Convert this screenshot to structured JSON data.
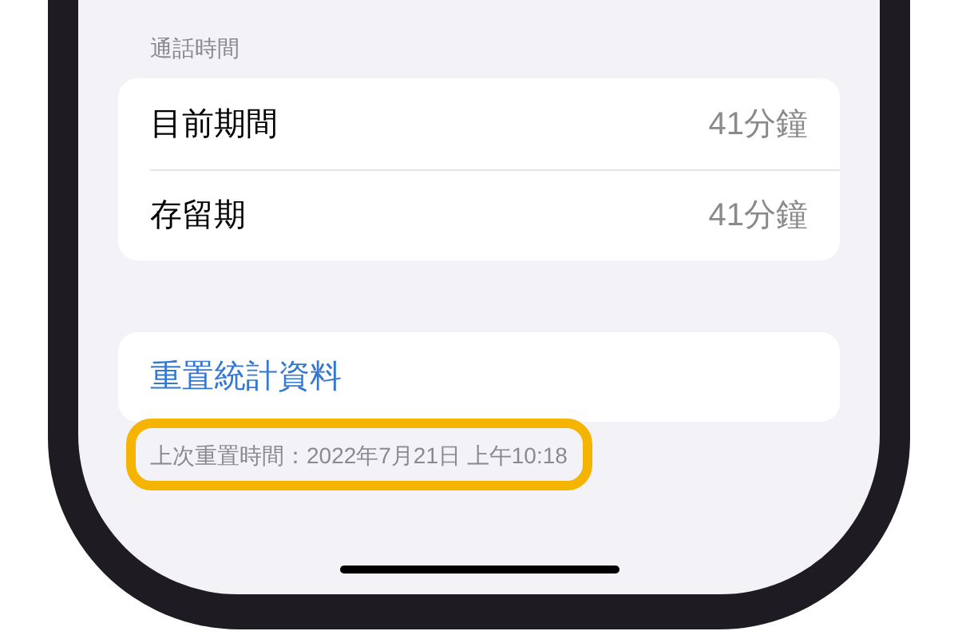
{
  "section_header": "通話時間",
  "call_time_rows": [
    {
      "label": "目前期間",
      "value": "41分鐘"
    },
    {
      "label": "存留期",
      "value": "41分鐘"
    }
  ],
  "reset_button": "重置統計資料",
  "last_reset_note": "上次重置時間：2022年7月21日 上午10:18",
  "note_highlighted": true
}
